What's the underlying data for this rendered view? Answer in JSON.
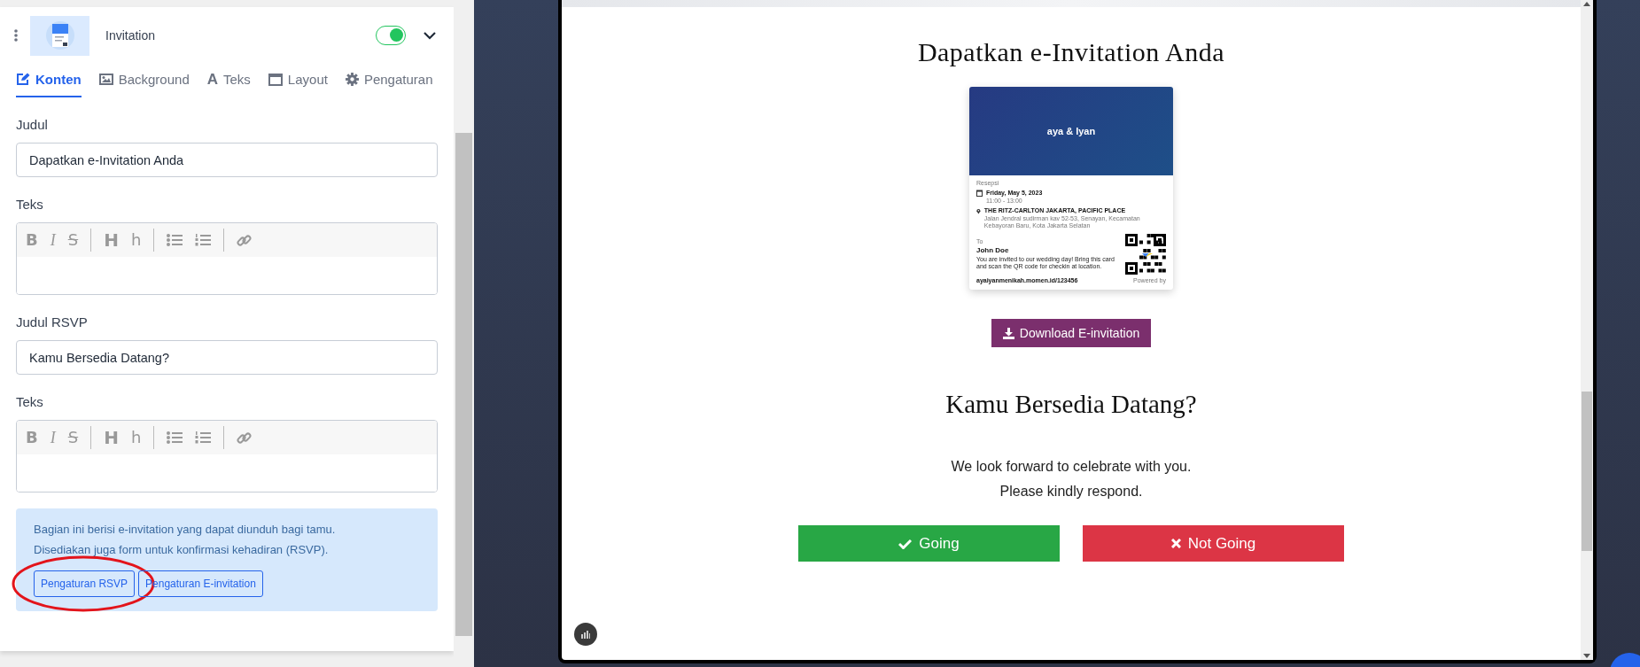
{
  "section": {
    "title": "Invitation",
    "enabled": true,
    "expanded": false
  },
  "tabs": [
    {
      "label": "Konten",
      "kind": "edit",
      "selected": true
    },
    {
      "label": "Background",
      "kind": "image",
      "selected": false
    },
    {
      "label": "Teks",
      "kind": "font",
      "glyph": "A",
      "selected": false
    },
    {
      "label": "Layout",
      "kind": "window",
      "selected": false
    },
    {
      "label": "Pengaturan",
      "kind": "gear",
      "selected": false
    }
  ],
  "fields": [
    {
      "kind": "input",
      "label": "Judul",
      "value": "Dapatkan e-Invitation Anda"
    },
    {
      "kind": "editor",
      "label": "Teks",
      "toolbar": [
        {
          "kind": "bold",
          "glyph": "B"
        },
        {
          "kind": "italic",
          "glyph": "I"
        },
        {
          "kind": "strike",
          "glyph": "S"
        },
        {
          "kind": "heading",
          "glyph": "H"
        },
        {
          "kind": "subheading",
          "glyph": "h"
        },
        {
          "kind": "ul"
        },
        {
          "kind": "ol"
        },
        {
          "kind": "link"
        }
      ]
    },
    {
      "kind": "input",
      "label": "Judul RSVP",
      "value": "Kamu Bersedia Datang?"
    },
    {
      "kind": "editor",
      "label": "Teks",
      "toolbar": [
        {
          "kind": "bold",
          "glyph": "B"
        },
        {
          "kind": "italic",
          "glyph": "I"
        },
        {
          "kind": "strike",
          "glyph": "S"
        },
        {
          "kind": "heading",
          "glyph": "H"
        },
        {
          "kind": "subheading",
          "glyph": "h"
        },
        {
          "kind": "ul"
        },
        {
          "kind": "ol"
        },
        {
          "kind": "link"
        }
      ]
    }
  ],
  "info": {
    "lines": [
      "Bagian ini berisi e-invitation yang dapat diunduh bagi tamu.",
      "Disediakan juga form untuk konfirmasi kehadiran (RSVP)."
    ],
    "buttons": [
      {
        "label": "Pengaturan RSVP",
        "circled": true
      },
      {
        "label": "Pengaturan E-invitation",
        "circled": false
      }
    ]
  },
  "preview": {
    "title": "Dapatkan e-Invitation Anda",
    "card": {
      "names": "aya & Iyan",
      "event": "Resepsi",
      "date": "Friday, May 5, 2023",
      "time": "11:00 - 13:00",
      "venue": "THE RITZ-CARLTON JAKARTA, PACIFIC PLACE",
      "address": "Jalan Jendral sudirman kav 52-53, Senayan, Kecamatan Kebayoran Baru, Kota Jakarta Selatan",
      "to_label": "To",
      "guest": "John Doe",
      "message": "You are invited to our wedding day! Bring this card and scan the QR code for checkin at location.",
      "url": "ayaiyanmenikah.momen.id/123456",
      "powered": "Powered by"
    },
    "download": "Download E-invitation",
    "rsvp_title": "Kamu Bersedia Datang?",
    "rsvp_lines": [
      "We look forward to celebrate with you.",
      "Please kindly respond."
    ],
    "answers": [
      {
        "kind": "going",
        "label": "Going"
      },
      {
        "kind": "not_going",
        "label": "Not Going"
      }
    ]
  }
}
